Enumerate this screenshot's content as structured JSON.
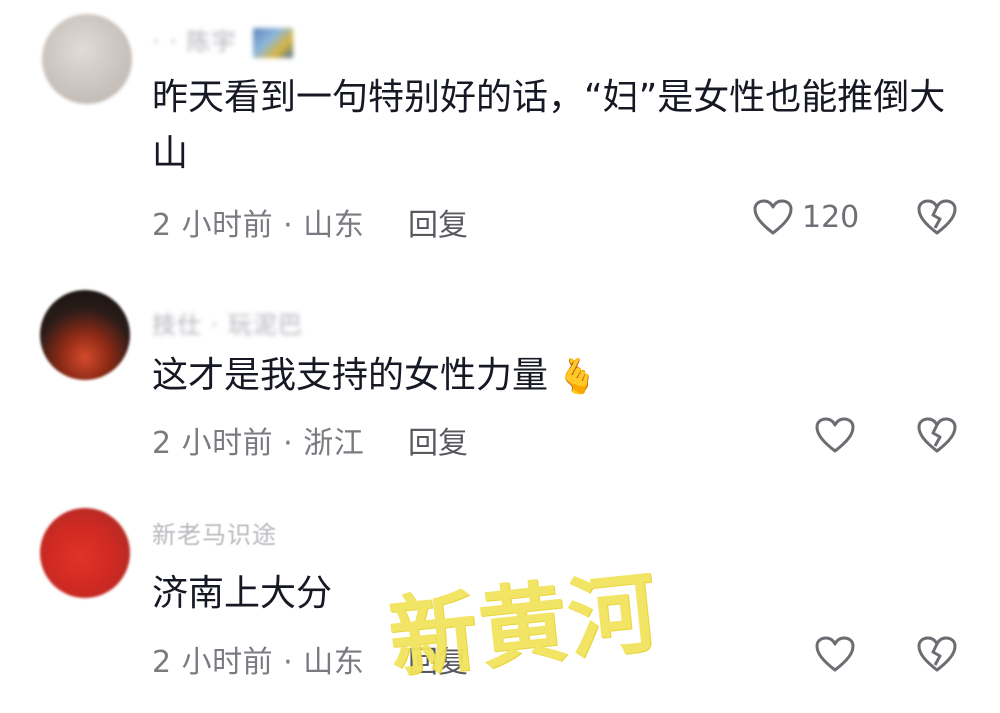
{
  "comments": [
    {
      "username": "· · 陈宇",
      "content": "昨天看到一句特别好的话，“妇”是女性也能推倒大山",
      "meta": "2 小时前 · 山东",
      "reply_label": "回复",
      "like_count": "120",
      "like_icon": "heart-outline-icon",
      "dislike_icon": "broken-heart-icon"
    },
    {
      "username": "技仕 · 玩泥巴",
      "content": "这才是我支持的女性力量",
      "emoji": "🫰",
      "meta": "2 小时前 · 浙江",
      "reply_label": "回复",
      "like_count": "",
      "like_icon": "heart-outline-icon",
      "dislike_icon": "broken-heart-icon"
    },
    {
      "username": "新老马识途",
      "content": "济南上大分",
      "meta": "2 小时前 · 山东",
      "reply_label": "回复",
      "like_count": "",
      "like_icon": "heart-outline-icon",
      "dislike_icon": "broken-heart-icon"
    }
  ],
  "watermark": "新黄河",
  "colors": {
    "text_primary": "#161823",
    "text_meta": "#7a7b80",
    "icon_stroke": "#6c6d73",
    "watermark": "#f2e35c"
  }
}
